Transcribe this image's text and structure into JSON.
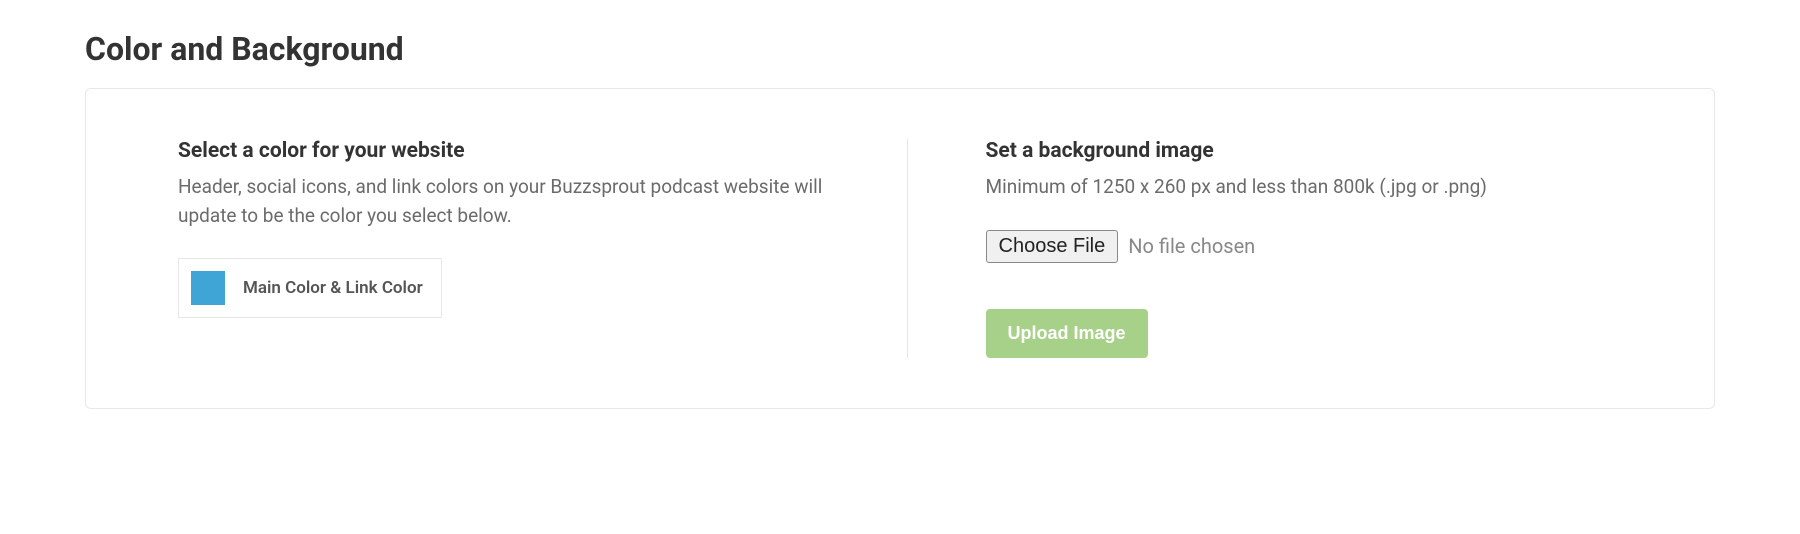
{
  "page_title": "Color and Background",
  "color_section": {
    "heading": "Select a color for your website",
    "description": "Header, social icons, and link colors on your Buzzsprout podcast website will update to be the color you select below.",
    "swatch_color": "#3ea5d6",
    "picker_label": "Main Color & Link Color"
  },
  "background_section": {
    "heading": "Set a background image",
    "description": "Minimum of 1250 x 260 px and less than 800k (.jpg or .png)",
    "choose_file_label": "Choose File",
    "file_status": "No file chosen",
    "upload_label": "Upload Image"
  }
}
